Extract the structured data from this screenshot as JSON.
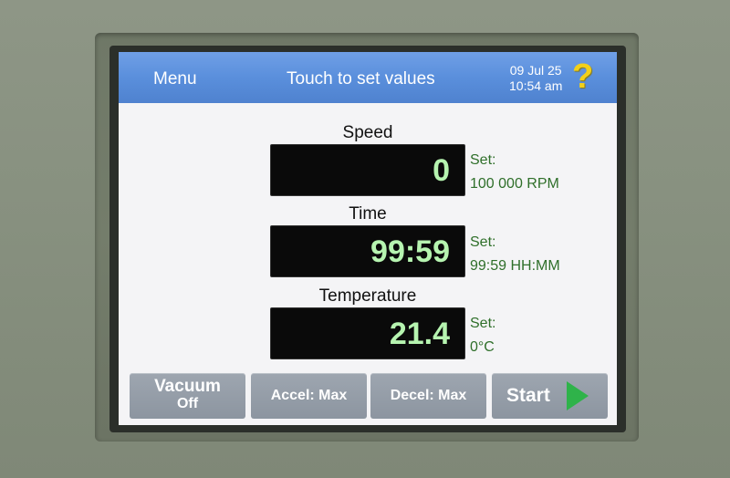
{
  "header": {
    "menu_label": "Menu",
    "subtitle": "Touch to set values",
    "date": "09 Jul 25",
    "time": "10:54 am",
    "help_glyph": "?"
  },
  "readouts": {
    "speed": {
      "label": "Speed",
      "value": "0",
      "set_label": "Set:",
      "set_value": "100 000 RPM"
    },
    "time": {
      "label": "Time",
      "value": "99:59",
      "set_label": "Set:",
      "set_value": "99:59 HH:MM"
    },
    "temperature": {
      "label": "Temperature",
      "value": "21.4",
      "set_label": "Set:",
      "set_value": "0°C"
    }
  },
  "buttons": {
    "vacuum": {
      "label": "Vacuum",
      "state": "Off"
    },
    "accel": {
      "label": "Accel: Max"
    },
    "decel": {
      "label": "Decel: Max"
    },
    "start": {
      "label": "Start",
      "icon": "play-arrow-icon"
    }
  },
  "colors": {
    "header": "#5a8fdc",
    "readout_text": "#b6f4b0",
    "set_text": "#2f6f2a",
    "start_arrow": "#2fb34a",
    "help_icon": "#f2d01a"
  }
}
